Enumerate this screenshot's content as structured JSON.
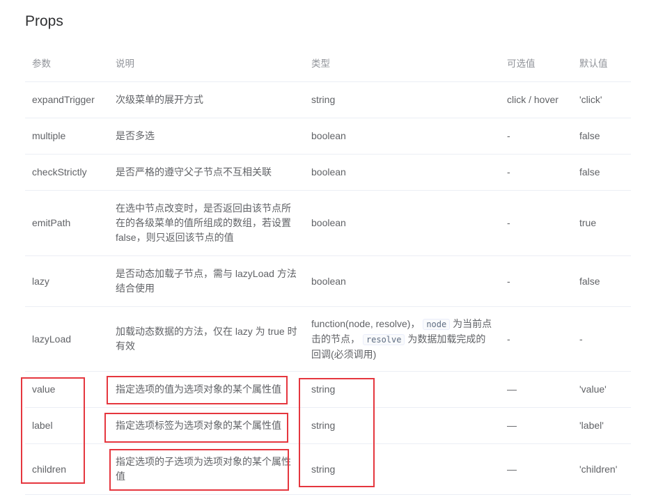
{
  "title": "Props",
  "columns": [
    "参数",
    "说明",
    "类型",
    "可选值",
    "默认值"
  ],
  "rows": [
    {
      "param": "expandTrigger",
      "desc": "次级菜单的展开方式",
      "type": "string",
      "options": "click / hover",
      "default": "'click'"
    },
    {
      "param": "multiple",
      "desc": "是否多选",
      "type": "boolean",
      "options": "-",
      "default": "false"
    },
    {
      "param": "checkStrictly",
      "desc": "是否严格的遵守父子节点不互相关联",
      "type": "boolean",
      "options": "-",
      "default": "false"
    },
    {
      "param": "emitPath",
      "desc": "在选中节点改变时，是否返回由该节点所在的各级菜单的值所组成的数组，若设置 false，则只返回该节点的值",
      "type": "boolean",
      "options": "-",
      "default": "true"
    },
    {
      "param": "lazy",
      "desc": "是否动态加载子节点，需与 lazyLoad 方法结合使用",
      "type": "boolean",
      "options": "-",
      "default": "false"
    },
    {
      "param": "lazyLoad",
      "desc": "加载动态数据的方法，仅在 lazy 为 true 时有效",
      "type_parts": [
        "function(node, resolve)，",
        "node",
        "为当前点击的节点，",
        "resolve",
        "为数据加载完成的回调(必须调用)"
      ],
      "options": "-",
      "default": "-"
    },
    {
      "param": "value",
      "desc": "指定选项的值为选项对象的某个属性值",
      "type": "string",
      "options": "—",
      "default": "'value'"
    },
    {
      "param": "label",
      "desc": "指定选项标签为选项对象的某个属性值",
      "type": "string",
      "options": "—",
      "default": "'label'"
    },
    {
      "param": "children",
      "desc": "指定选项的子选项为选项对象的某个属性值",
      "type": "string",
      "options": "—",
      "default": "'children'"
    }
  ],
  "highlight_color": "#e5363e"
}
